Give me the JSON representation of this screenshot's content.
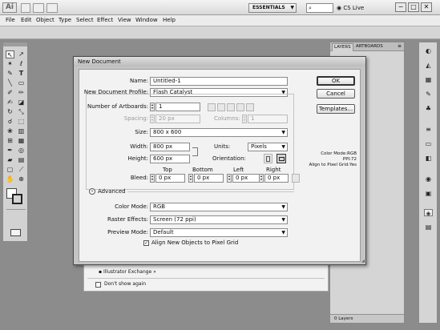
{
  "app": {
    "logo": "Ai",
    "workspace": "ESSENTIALS",
    "cs_live": "CS Live"
  },
  "menu": [
    "File",
    "Edit",
    "Object",
    "Type",
    "Select",
    "Effect",
    "View",
    "Window",
    "Help"
  ],
  "dock": {
    "tab_layers": "LAYERS",
    "tab_artboards": "ARTBOARDS",
    "layers_count": "0 Layers"
  },
  "welcome": {
    "exchange_link": "Illustrator Exchange »",
    "dont_show": "Don't show again"
  },
  "dialog": {
    "title": "New Document",
    "name_label": "Name:",
    "name_value": "Untitled-1",
    "profile_label": "New Document Profile:",
    "profile_value": "Flash Catalyst",
    "artboards_label": "Number of Artboards:",
    "artboards_value": "1",
    "spacing_label": "Spacing:",
    "spacing_value": "20 px",
    "columns_label": "Columns:",
    "columns_value": "1",
    "size_label": "Size:",
    "size_value": "800 x 600",
    "width_label": "Width:",
    "width_value": "800 px",
    "units_label": "Units:",
    "units_value": "Pixels",
    "height_label": "Height:",
    "height_value": "600 px",
    "orientation_label": "Orientation:",
    "bleed_label": "Bleed:",
    "bleed_headers": [
      "Top",
      "Bottom",
      "Left",
      "Right"
    ],
    "bleed_values": [
      "0 px",
      "0 px",
      "0 px",
      "0 px"
    ],
    "advanced_label": "Advanced",
    "color_mode_label": "Color Mode:",
    "color_mode_value": "RGB",
    "raster_label": "Raster Effects:",
    "raster_value": "Screen (72 ppi)",
    "preview_label": "Preview Mode:",
    "preview_value": "Default",
    "align_label": "Align New Objects to Pixel Grid",
    "ok": "OK",
    "cancel": "Cancel",
    "templates": "Templates...",
    "info_color_mode": "Color Mode:RGB",
    "info_ppi": "PPI:72",
    "info_align": "Align to Pixel Grid:Yes"
  },
  "tool_icons": [
    "selection-icon",
    "direct-selection-icon",
    "magic-wand-icon",
    "lasso-icon",
    "pen-icon",
    "type-icon",
    "line-icon",
    "rectangle-icon",
    "paintbrush-icon",
    "pencil-icon",
    "blob-brush-icon",
    "eraser-icon",
    "rotate-icon",
    "scale-icon",
    "warp-icon",
    "free-transform-icon",
    "symbol-sprayer-icon",
    "column-graph-icon",
    "mesh-icon",
    "gradient-icon",
    "eyedropper-icon",
    "blend-icon",
    "live-paint-icon",
    "live-paint-selection-icon",
    "artboard-icon",
    "slice-icon",
    "hand-icon",
    "zoom-icon"
  ]
}
